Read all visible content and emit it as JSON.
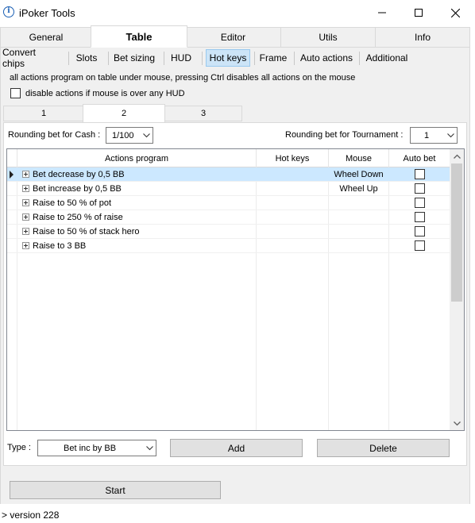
{
  "window": {
    "title": "iPoker Tools",
    "icon": "i",
    "minimize_icon": "minimize-icon",
    "maximize_icon": "maximize-icon",
    "close_icon": "close-icon"
  },
  "main_tabs": [
    {
      "label": "General",
      "active": false
    },
    {
      "label": "Table",
      "active": true
    },
    {
      "label": "Editor",
      "active": false
    },
    {
      "label": "Utils",
      "active": false
    },
    {
      "label": "Info",
      "active": false
    }
  ],
  "sub_tabs": [
    {
      "label": "Convert chips",
      "active": false
    },
    {
      "label": "Slots",
      "active": false
    },
    {
      "label": "Bet sizing",
      "active": false
    },
    {
      "label": "HUD",
      "active": false
    },
    {
      "label": "Hot keys",
      "active": true
    },
    {
      "label": "Frame",
      "active": false
    },
    {
      "label": "Auto actions",
      "active": false
    },
    {
      "label": "Additional",
      "active": false
    }
  ],
  "hotkeys": {
    "info": "all actions program on table under mouse, pressing Ctrl disables all actions on the mouse",
    "disable_hud_label": "disable actions if mouse is over any HUD",
    "disable_hud_checked": false
  },
  "profile_tabs": [
    {
      "label": "1",
      "active": false
    },
    {
      "label": "2",
      "active": true
    },
    {
      "label": "3",
      "active": false
    }
  ],
  "rounding": {
    "cash_label": "Rounding bet for Cash :",
    "cash_value": "1/100",
    "tournament_label": "Rounding bet for Tournament :",
    "tournament_value": "1"
  },
  "grid": {
    "columns": [
      "Actions program",
      "Hot keys",
      "Mouse",
      "Auto bet"
    ],
    "rows": [
      {
        "action": "Bet decrease by 0,5 BB",
        "hotkey": "",
        "mouse": "Wheel Down",
        "auto_bet": false,
        "selected": true
      },
      {
        "action": "Bet increase by 0,5 BB",
        "hotkey": "",
        "mouse": "Wheel Up",
        "auto_bet": false,
        "selected": false
      },
      {
        "action": "Raise to 50 % of pot",
        "hotkey": "",
        "mouse": "",
        "auto_bet": false,
        "selected": false
      },
      {
        "action": "Raise to 250 % of raise",
        "hotkey": "",
        "mouse": "",
        "auto_bet": false,
        "selected": false
      },
      {
        "action": "Raise to 50 % of stack hero",
        "hotkey": "",
        "mouse": "",
        "auto_bet": false,
        "selected": false
      },
      {
        "action": "Raise to 3 BB",
        "hotkey": "",
        "mouse": "",
        "auto_bet": false,
        "selected": false
      }
    ]
  },
  "bottom": {
    "type_label": "Type :",
    "type_value": "Bet inc by BB",
    "add_label": "Add",
    "delete_label": "Delete",
    "start_label": "Start"
  },
  "status": {
    "version": "> version 228"
  }
}
